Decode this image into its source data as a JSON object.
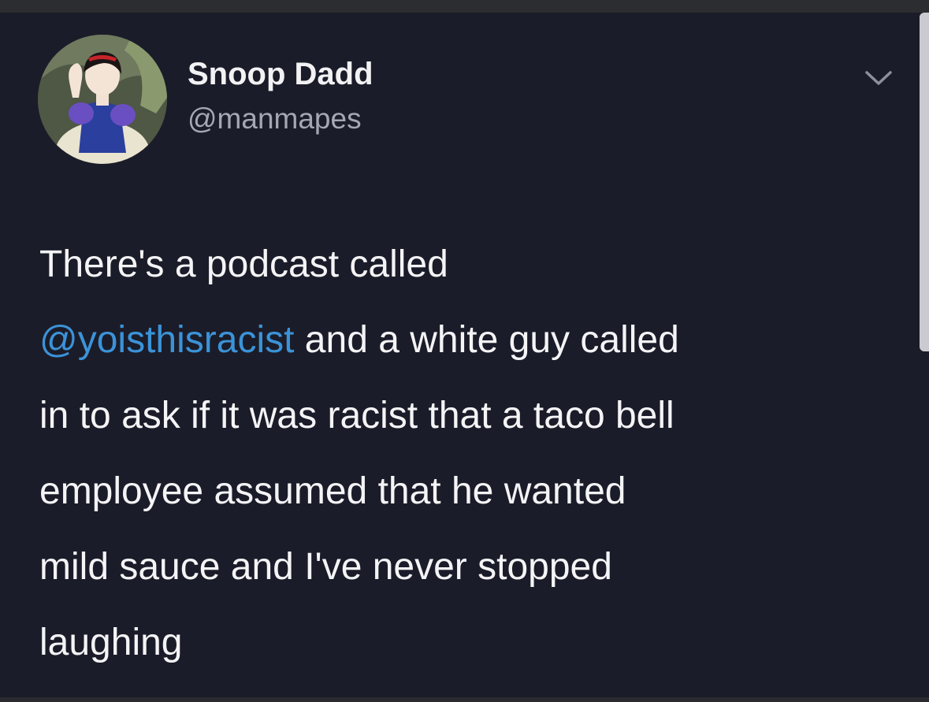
{
  "tweet": {
    "author": {
      "display_name": "Snoop Dadd",
      "handle": "@manmapes"
    },
    "menu_icon": "chevron-down-icon",
    "text_lines": [
      {
        "before": "There's a podcast called",
        "mention": "",
        "after": ""
      },
      {
        "before": "",
        "mention": "@yoisthisracist",
        "after": " and a white guy called"
      },
      {
        "before": "in to ask if it was racist that a taco bell",
        "mention": "",
        "after": ""
      },
      {
        "before": "employee assumed that he wanted",
        "mention": "",
        "after": ""
      },
      {
        "before": "mild sauce and I've never stopped",
        "mention": "",
        "after": ""
      },
      {
        "before": "laughing",
        "mention": "",
        "after": ""
      }
    ]
  },
  "colors": {
    "background": "#1b1c29",
    "text": "#f4f4f6",
    "secondary_text": "#a3a8b3",
    "link": "#3b93d8"
  }
}
